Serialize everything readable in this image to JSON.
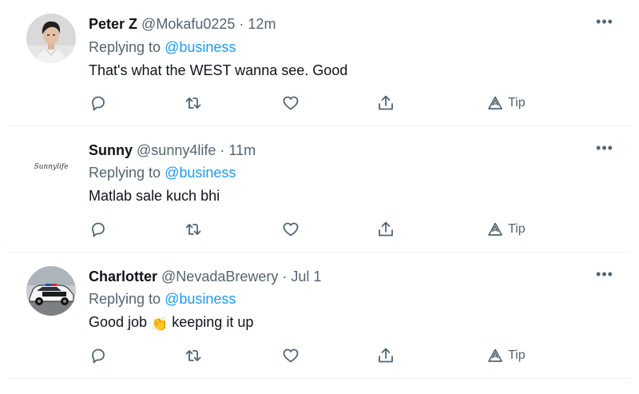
{
  "tweets": [
    {
      "display_name": "Peter Z",
      "handle": "@Mokafu0225",
      "separator": "·",
      "time": "12m",
      "replying_prefix": "Replying to",
      "replying_handle": "@business",
      "text": "That's what the WEST wanna see. Good",
      "avatar": "profile-photo-man",
      "more_icon": "more-dots-icon",
      "actions": {
        "tip_label": "Tip"
      }
    },
    {
      "display_name": "Sunny",
      "handle": "@sunny4life",
      "separator": "·",
      "time": "11m",
      "replying_prefix": "Replying to",
      "replying_handle": "@business",
      "text": "Matlab sale kuch bhi",
      "avatar": "script-logo-avatar",
      "avatar_logo_text": "Sunnylife",
      "more_icon": "more-dots-icon",
      "actions": {
        "tip_label": "Tip"
      }
    },
    {
      "display_name": "Charlotter",
      "handle": "@NevadaBrewery",
      "separator": "·",
      "time": "Jul 1",
      "replying_prefix": "Replying to",
      "replying_handle": "@business",
      "text_before_emoji": "Good job",
      "emoji": "👏",
      "text_after_emoji": "keeping it up",
      "avatar": "police-car-photo",
      "more_icon": "more-dots-icon",
      "actions": {
        "tip_label": "Tip"
      }
    }
  ],
  "icons": [
    "reply-icon",
    "retweet-icon",
    "like-icon",
    "share-icon",
    "tip-icon"
  ],
  "colors": {
    "link": "#1d9bf0",
    "secondary_text": "#536471",
    "primary_text": "#0f1419",
    "divider": "#eff3f4"
  }
}
